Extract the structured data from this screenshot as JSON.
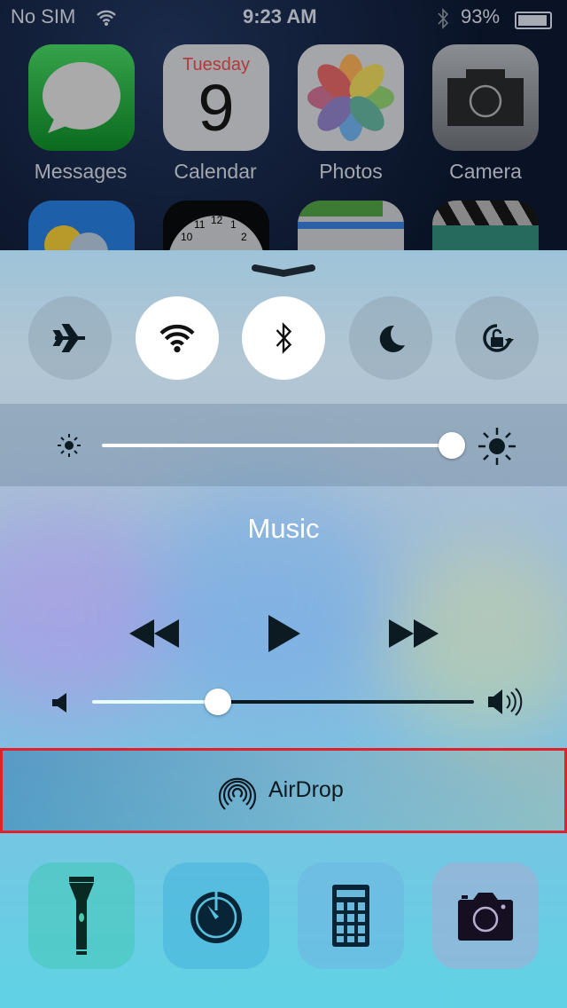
{
  "status_bar": {
    "carrier": "No SIM",
    "time": "9:23 AM",
    "battery": "93%",
    "battery_level": 0.93,
    "icons": [
      "wifi-icon",
      "bluetooth-icon",
      "battery-icon"
    ]
  },
  "home_apps": [
    {
      "label": "Messages"
    },
    {
      "label": "Calendar",
      "day": "Tuesday",
      "date": "9"
    },
    {
      "label": "Photos"
    },
    {
      "label": "Camera"
    }
  ],
  "clock_numbers": [
    "12",
    "1",
    "2",
    "10",
    "11"
  ],
  "control_center": {
    "toggles": [
      {
        "name": "airplane-mode",
        "on": false
      },
      {
        "name": "wifi",
        "on": true
      },
      {
        "name": "bluetooth",
        "on": true
      },
      {
        "name": "do-not-disturb",
        "on": false
      },
      {
        "name": "rotation-lock",
        "on": false
      }
    ],
    "brightness": 1.0,
    "music": {
      "title": "Music",
      "volume": 0.33
    },
    "airdrop": {
      "label": "AirDrop",
      "highlight_color": "#e0202a"
    },
    "shortcuts": [
      "flashlight",
      "timer",
      "calculator",
      "camera"
    ]
  }
}
